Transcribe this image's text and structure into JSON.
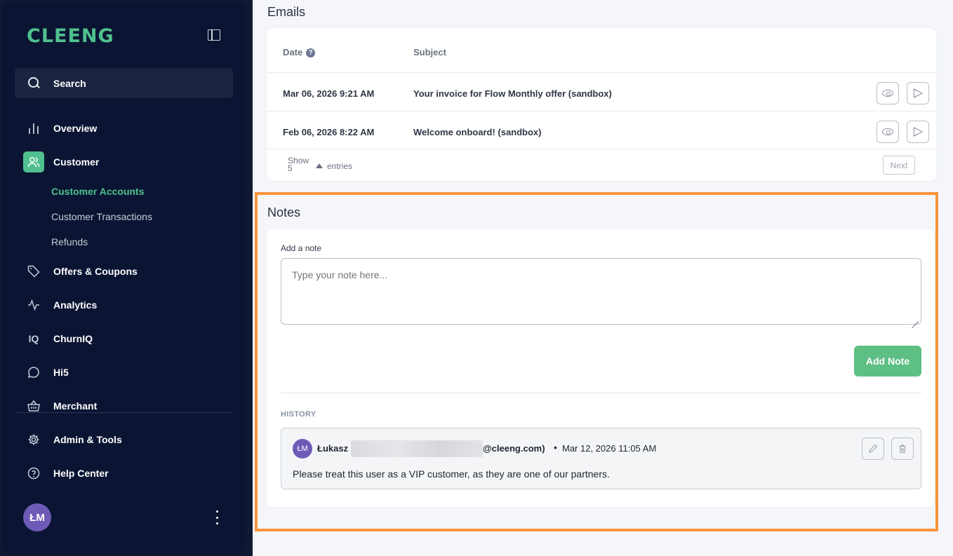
{
  "sidebar": {
    "logo": "CLEENG",
    "search_label": "Search",
    "items": [
      {
        "label": "Overview",
        "icon": "bar-chart-icon"
      },
      {
        "label": "Customer",
        "icon": "users-icon"
      },
      {
        "label": "Offers & Coupons",
        "icon": "tag-icon"
      },
      {
        "label": "Analytics",
        "icon": "activity-icon"
      },
      {
        "label": "ChurnIQ",
        "icon": "churniq-icon"
      },
      {
        "label": "Hi5",
        "icon": "chat-bubble-icon"
      },
      {
        "label": "Merchant",
        "icon": "basket-icon"
      },
      {
        "label": "Admin & Tools",
        "icon": "gear-icon"
      },
      {
        "label": "Help Center",
        "icon": "help-circle-icon"
      }
    ],
    "sub_items": [
      "Customer Accounts",
      "Customer Transactions",
      "Refunds"
    ],
    "user_initials": "ŁM"
  },
  "emails": {
    "title": "Emails",
    "col_date": "Date",
    "col_subject": "Subject",
    "help_glyph": "?",
    "rows": [
      {
        "date": "Mar 06, 2026 9:21 AM",
        "subject": "Your invoice for Flow Monthly offer (sandbox)"
      },
      {
        "date": "Feb 06, 2026 8:22 AM",
        "subject": "Welcome onboard! (sandbox)"
      }
    ],
    "show_label": "Show",
    "show_count": "5",
    "entries_label": "entries",
    "next_label": "Next"
  },
  "notes": {
    "title": "Notes",
    "add_label": "Add a note",
    "placeholder": "Type your note here...",
    "add_button": "Add Note",
    "history_label": "HISTORY",
    "history": [
      {
        "initials": "ŁM",
        "name": "Łukasz",
        "email_suffix": "@cleeng.com)",
        "separator": "•",
        "date": "Mar 12, 2026 11:05 AM",
        "text": "Please treat this user as a VIP customer, as they are one of our partners."
      }
    ]
  },
  "colors": {
    "accent": "#4fc08d",
    "highlight": "#f7963c",
    "sidebar_bg": "#0b1533"
  }
}
